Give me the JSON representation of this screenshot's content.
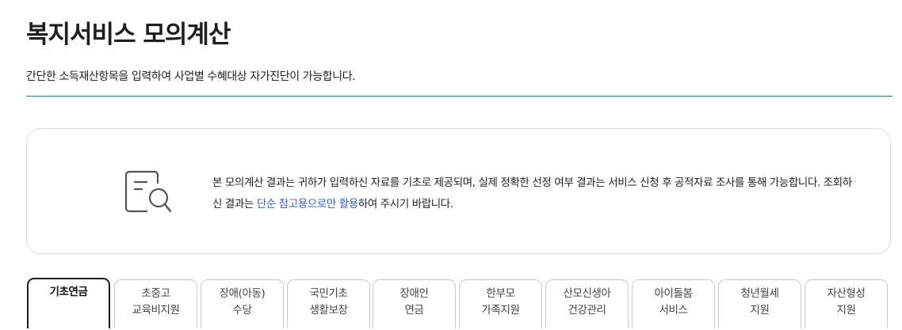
{
  "header": {
    "title": "복지서비스 모의계산",
    "description": "간단한 소득재산항목을 입력하여 사업별 수혜대상 자가진단이 가능합니다."
  },
  "notice": {
    "icon": "document-search-icon",
    "text_before": "본 모의계산 결과는 귀하가 입력하신 자료를 기초로 제공되며, 실제 정확한 선정 여부 결과는 서비스 신청 후 공적자료 조사를 통해 가능합니다. 조회하신 결과는 ",
    "highlight": "단순 참고용으로만 활용",
    "text_after": "하여 주시기 바랍니다.",
    "highlight_color": "#2f5fc9"
  },
  "tabs": [
    {
      "line1": "기초연금",
      "line2": "",
      "active": true
    },
    {
      "line1": "초중고",
      "line2": "교육비지원",
      "active": false
    },
    {
      "line1": "장애(아동)",
      "line2": "수당",
      "active": false
    },
    {
      "line1": "국민기초",
      "line2": "생활보장",
      "active": false
    },
    {
      "line1": "장애인",
      "line2": "연금",
      "active": false
    },
    {
      "line1": "한부모",
      "line2": "가족지원",
      "active": false
    },
    {
      "line1": "산모신생아",
      "line2": "건강관리",
      "active": false
    },
    {
      "line1": "아이돌봄",
      "line2": "서비스",
      "active": false
    },
    {
      "line1": "청년월세",
      "line2": "지원",
      "active": false
    },
    {
      "line1": "자산형성",
      "line2": "지원",
      "active": false
    }
  ],
  "colors": {
    "divider": "#2a7a6e",
    "active_tab_border": "#1e1e1e"
  }
}
